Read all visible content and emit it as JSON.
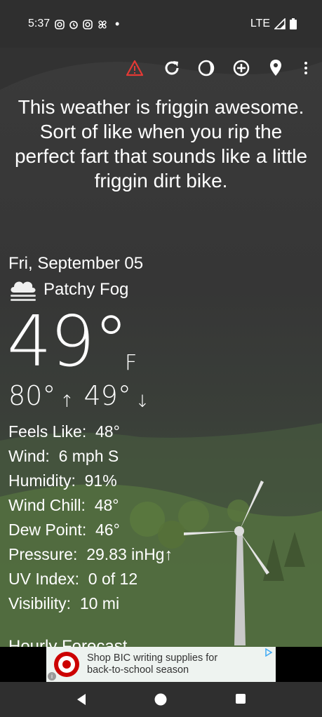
{
  "status_bar": {
    "time": "5:37",
    "notification_icons": [
      "instagram-icon",
      "alarm-icon",
      "instagram-icon",
      "pinwheel-icon",
      "dot-icon"
    ],
    "network": "LTE"
  },
  "toolbar": {
    "icons": [
      "alert-icon",
      "refresh-icon",
      "theme-icon",
      "add-location-icon",
      "location-pin-icon",
      "more-icon"
    ],
    "alert_color": "#e53935"
  },
  "quote": "This weather is friggin awesome. Sort of like when you rip the perfect fart that sounds like a little friggin dirt bike.",
  "current": {
    "date": "Fri, September 05",
    "condition": "Patchy Fog",
    "condition_icon": "fog-cloud-icon",
    "temp": "49°",
    "unit": "F",
    "high": "80°",
    "low": "49°"
  },
  "details": [
    {
      "label": "Feels Like:",
      "value": "48°"
    },
    {
      "label": "Wind:",
      "value": "6 mph S"
    },
    {
      "label": "Humidity:",
      "value": "91%"
    },
    {
      "label": "Wind Chill:",
      "value": "48°"
    },
    {
      "label": "Dew Point:",
      "value": "46°"
    },
    {
      "label": "Pressure:",
      "value": "29.83 inHg↑"
    },
    {
      "label": "UV Index:",
      "value": "0 of 12"
    },
    {
      "label": "Visibility:",
      "value": "10 mi"
    }
  ],
  "hourly_heading": "Hourly Forecast",
  "ad": {
    "text_line1": "Shop BIC writing supplies for",
    "text_line2": "back-to-school season",
    "brand_color": "#cc0000"
  }
}
